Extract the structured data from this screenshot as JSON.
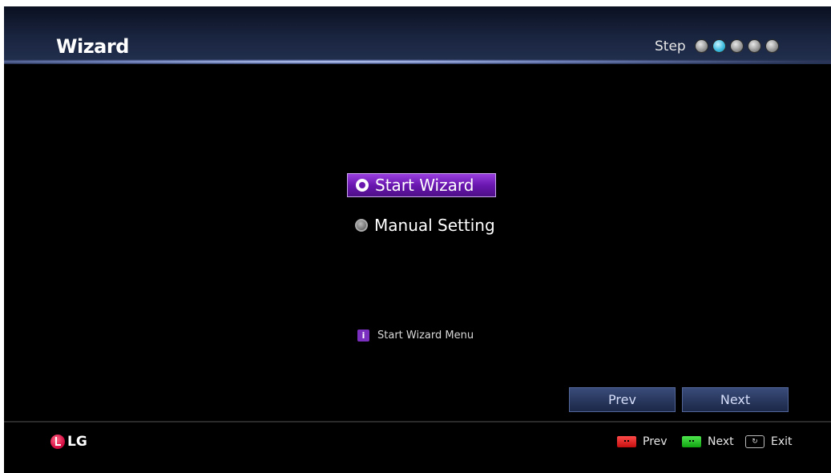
{
  "header": {
    "title": "Wizard",
    "step_label": "Step",
    "steps_total": 5,
    "current_step": 2
  },
  "options": [
    {
      "label": "Start Wizard",
      "selected": true
    },
    {
      "label": "Manual Setting",
      "selected": false
    }
  ],
  "info": {
    "icon": "info-icon",
    "text": "Start Wizard Menu"
  },
  "buttons": {
    "prev": "Prev",
    "next": "Next"
  },
  "footer": {
    "logo": "LG",
    "hints": [
      {
        "key": "red-key",
        "label": "Prev"
      },
      {
        "key": "green-key",
        "label": "Next"
      },
      {
        "key": "exit-key",
        "label": "Exit"
      }
    ]
  },
  "colors": {
    "accent": "#6a17b0",
    "active_step": "#41bde0",
    "background": "#000000"
  }
}
